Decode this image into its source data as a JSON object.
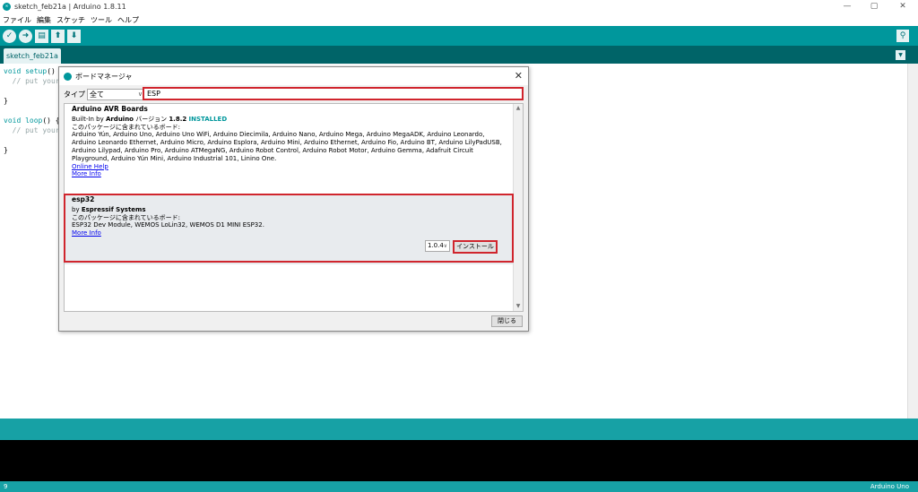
{
  "window": {
    "title": "sketch_feb21a | Arduino 1.8.11",
    "minimize": "—",
    "maximize": "▢",
    "close": "✕"
  },
  "menu": [
    "ファイル",
    "編集",
    "スケッチ",
    "ツール",
    "ヘルプ"
  ],
  "toolbar": {
    "verify": "✓",
    "upload": "➜",
    "new": "▤",
    "open": "⬆",
    "save": "⬇",
    "serial": "⚲"
  },
  "tab": {
    "label": "sketch_feb21a",
    "menu": "▼"
  },
  "editor": {
    "lines": [
      {
        "kw": "void ",
        "fn": "setup",
        "rest": "() {"
      },
      {
        "cm": "  // put your"
      },
      {
        "plain": ""
      },
      {
        "plain": "}"
      },
      {
        "plain": ""
      },
      {
        "kw": "void ",
        "fn": "loop",
        "rest": "() {"
      },
      {
        "cm": "  // put your"
      },
      {
        "plain": ""
      },
      {
        "plain": "}"
      }
    ]
  },
  "status": {
    "line": "9",
    "board": "Arduino Uno"
  },
  "dialog": {
    "title": "ボードマネージャ",
    "close": "✕",
    "type_label": "タイプ",
    "type_value": "全て",
    "search_value": "ESP",
    "packages": [
      {
        "name": "Arduino AVR Boards",
        "by_prefix": "Built-In by ",
        "author": "Arduino",
        "version_prefix": " バージョン ",
        "version": "1.8.2",
        "installed": "INSTALLED",
        "included_label": "このパッケージに含まれているボード:",
        "boards": "Arduino Yún, Arduino Uno, Arduino Uno WiFi, Arduino Diecimila, Arduino Nano, Arduino Mega, Arduino MegaADK, Arduino Leonardo, Arduino Leonardo Ethernet, Arduino Micro, Arduino Esplora, Arduino Mini, Arduino Ethernet, Arduino Fio, Arduino BT, Arduino LilyPadUSB, Arduino Lilypad, Arduino Pro, Arduino ATMegaNG, Arduino Robot Control, Arduino Robot Motor, Arduino Gemma, Adafruit Circuit Playground, Arduino Yún Mini, Arduino Industrial 101, Linino One.",
        "online_help": "Online Help",
        "more_info": "More Info"
      },
      {
        "name": "esp32",
        "by_prefix": "by ",
        "author": "Espressif Systems",
        "included_label": "このパッケージに含まれているボード:",
        "boards": "ESP32 Dev Module, WEMOS LoLin32, WEMOS D1 MINI ESP32.",
        "more_info": "More Info",
        "version_select": "1.0.4",
        "install": "インストール"
      }
    ],
    "close_button": "閉じる"
  }
}
